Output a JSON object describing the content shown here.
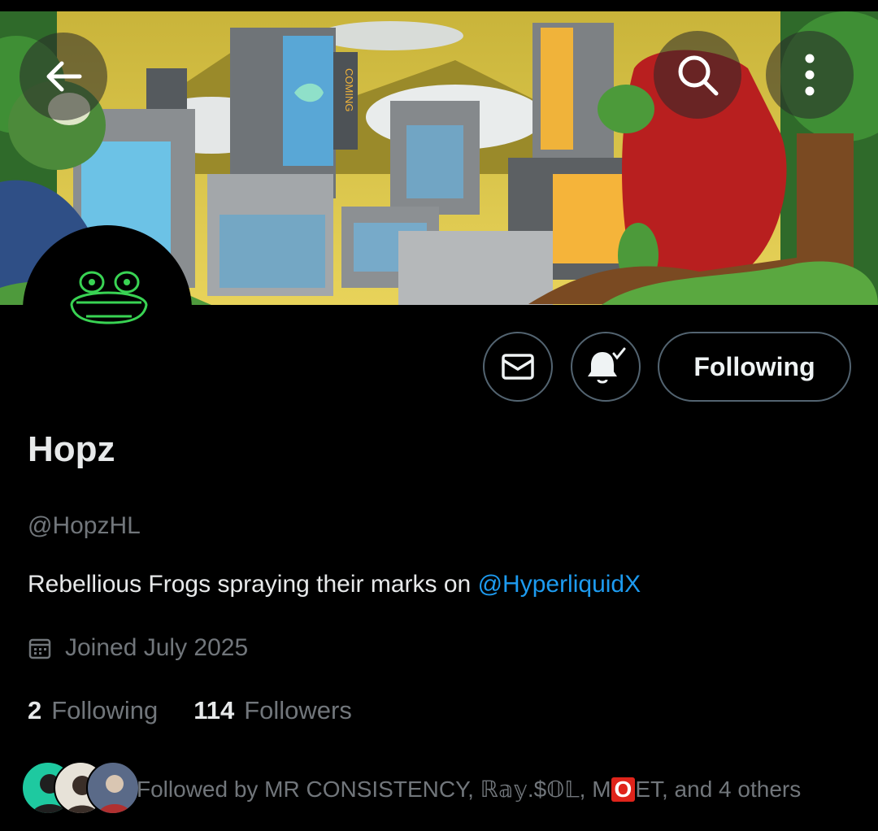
{
  "profile": {
    "display_name": "Hopz",
    "handle": "@HopzHL",
    "bio_text": "Rebellious Frogs spraying their marks on ",
    "bio_mention": "@HyperliquidX",
    "joined": "Joined July 2025",
    "following_count": "2",
    "following_label": "Following",
    "followers_count": "114",
    "followers_label": "Followers"
  },
  "banner": {
    "sign_text": "COMING"
  },
  "actions": {
    "follow_button_label": "Following",
    "message_icon": "envelope-icon",
    "notify_icon": "bell-check-icon"
  },
  "header_icons": {
    "back": "arrow-left-icon",
    "search": "search-icon",
    "more": "more-vertical-icon"
  },
  "followed_by": {
    "prefix": "Followed by MR CONSISTENCY, ",
    "name2": "ℝ𝕒𝕪.$𝕆𝕃",
    "sep": ", M",
    "o_char": "O",
    "after_o": "ET, and 4 others"
  },
  "colors": {
    "accent": "#1d9bf0",
    "muted": "#71767b",
    "text": "#e7e9ea",
    "border": "#536471",
    "frog_green": "#39d353"
  }
}
